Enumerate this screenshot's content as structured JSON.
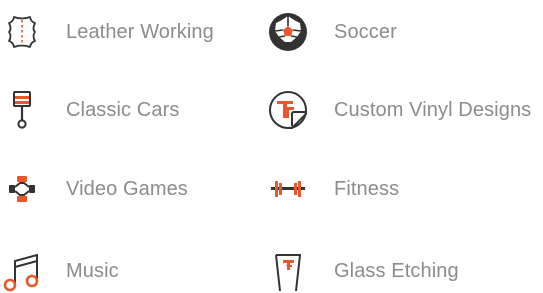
{
  "colors": {
    "icon_dark": "#333333",
    "icon_accent": "#e8582a",
    "label_text": "#8c8c8c"
  },
  "items": [
    {
      "label": "Leather Working",
      "icon": "leather-hide-icon"
    },
    {
      "label": "Soccer",
      "icon": "soccer-ball-icon"
    },
    {
      "label": "Classic Cars",
      "icon": "piston-icon"
    },
    {
      "label": "Custom Vinyl Designs",
      "icon": "vinyl-sticker-icon"
    },
    {
      "label": "Video Games",
      "icon": "game-controller-icon"
    },
    {
      "label": "Fitness",
      "icon": "dumbbell-icon"
    },
    {
      "label": "Music",
      "icon": "music-note-icon"
    },
    {
      "label": "Glass Etching",
      "icon": "etched-glass-icon"
    }
  ]
}
